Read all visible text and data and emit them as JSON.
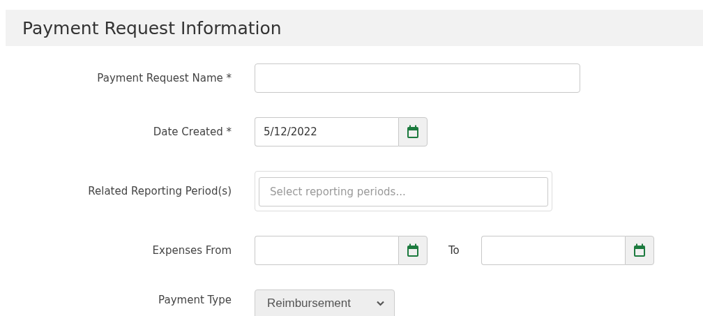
{
  "section": {
    "title": "Payment Request Information"
  },
  "fields": [
    {
      "kind": "text",
      "label": "Payment Request Name *"
    },
    {
      "kind": "date",
      "label": "Date Created *",
      "value": "5/12/2022"
    },
    {
      "kind": "multiselect",
      "label": "Related Reporting Period(s)",
      "placeholder": "Select reporting periods..."
    },
    {
      "kind": "daterange",
      "label": "Expenses From",
      "separator": "To"
    },
    {
      "kind": "select",
      "label": "Payment Type",
      "value": "Reimbursement"
    }
  ]
}
